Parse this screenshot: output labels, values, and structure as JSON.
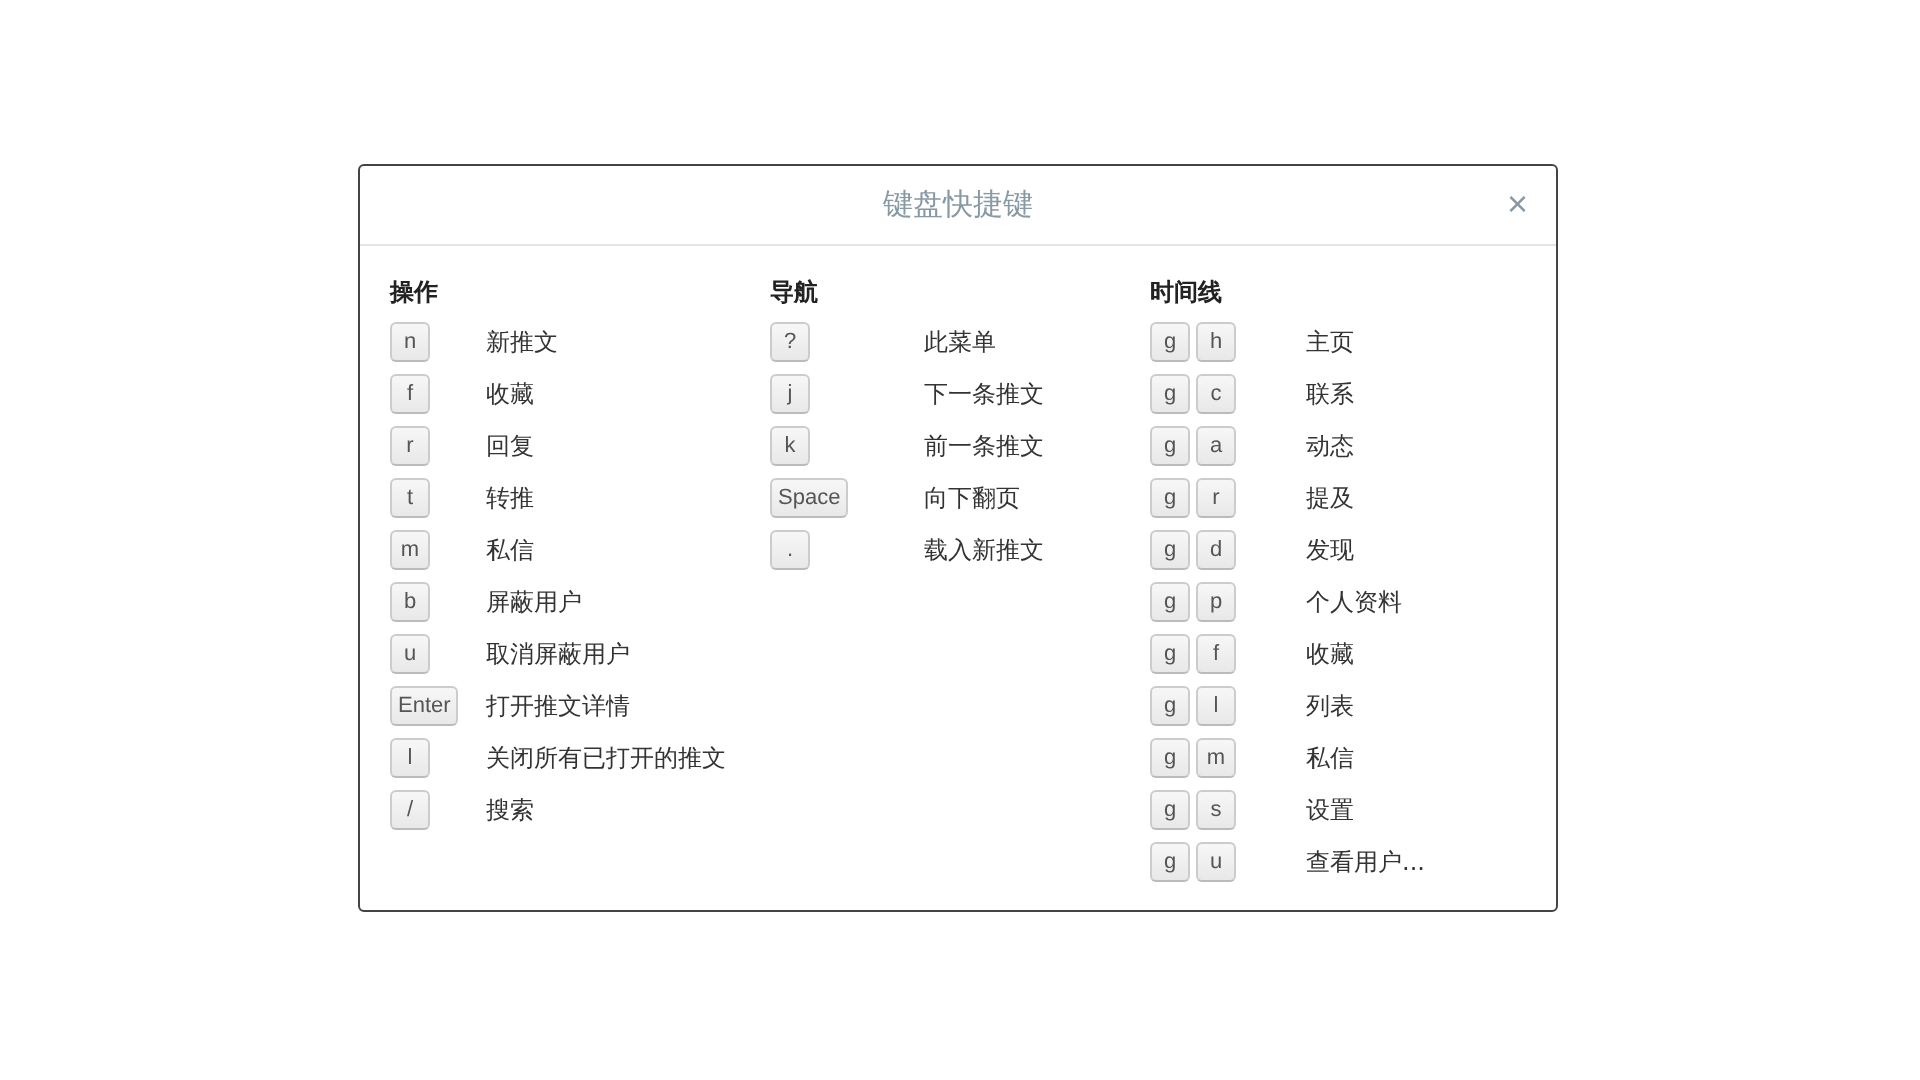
{
  "dialog": {
    "title": "键盘快捷键",
    "close": "×"
  },
  "sections": [
    {
      "heading": "操作",
      "shortcuts": [
        {
          "keys": [
            "n"
          ],
          "label": "新推文"
        },
        {
          "keys": [
            "f"
          ],
          "label": "收藏"
        },
        {
          "keys": [
            "r"
          ],
          "label": "回复"
        },
        {
          "keys": [
            "t"
          ],
          "label": "转推"
        },
        {
          "keys": [
            "m"
          ],
          "label": "私信"
        },
        {
          "keys": [
            "b"
          ],
          "label": "屏蔽用户"
        },
        {
          "keys": [
            "u"
          ],
          "label": "取消屏蔽用户"
        },
        {
          "keys": [
            "Enter"
          ],
          "label": "打开推文详情"
        },
        {
          "keys": [
            "l"
          ],
          "label": "关闭所有已打开的推文"
        },
        {
          "keys": [
            "/"
          ],
          "label": "搜索"
        }
      ]
    },
    {
      "heading": "导航",
      "shortcuts": [
        {
          "keys": [
            "?"
          ],
          "label": "此菜单"
        },
        {
          "keys": [
            "j"
          ],
          "label": "下一条推文"
        },
        {
          "keys": [
            "k"
          ],
          "label": "前一条推文"
        },
        {
          "keys": [
            "Space"
          ],
          "label": "向下翻页"
        },
        {
          "keys": [
            "."
          ],
          "label": "载入新推文"
        }
      ]
    },
    {
      "heading": "时间线",
      "shortcuts": [
        {
          "keys": [
            "g",
            "h"
          ],
          "label": "主页"
        },
        {
          "keys": [
            "g",
            "c"
          ],
          "label": "联系"
        },
        {
          "keys": [
            "g",
            "a"
          ],
          "label": "动态"
        },
        {
          "keys": [
            "g",
            "r"
          ],
          "label": "提及"
        },
        {
          "keys": [
            "g",
            "d"
          ],
          "label": "发现"
        },
        {
          "keys": [
            "g",
            "p"
          ],
          "label": "个人资料"
        },
        {
          "keys": [
            "g",
            "f"
          ],
          "label": "收藏"
        },
        {
          "keys": [
            "g",
            "l"
          ],
          "label": "列表"
        },
        {
          "keys": [
            "g",
            "m"
          ],
          "label": "私信"
        },
        {
          "keys": [
            "g",
            "s"
          ],
          "label": "设置"
        },
        {
          "keys": [
            "g",
            "u"
          ],
          "label": "查看用户..."
        }
      ]
    }
  ]
}
